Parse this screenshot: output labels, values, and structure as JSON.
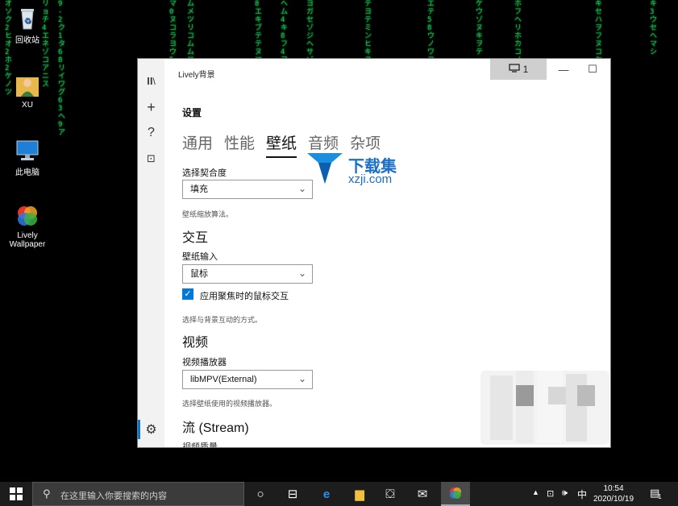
{
  "desktop": {
    "icons": [
      {
        "label": "回收站",
        "icon": "recycle-bin-icon"
      },
      {
        "label": "XU",
        "icon": "user-folder-icon"
      },
      {
        "label": "此电脑",
        "icon": "computer-icon"
      },
      {
        "label": "Lively Wallpaper",
        "icon": "lively-app-icon"
      }
    ],
    "matrix_columns": [
      "オ\nソ\nク\n2\nヒ\nオ\n2\nホ\n2\nケ\nノ\nツ",
      "リ\nョ\nチ\n4\nエ\nネ\nゾ\nコ\nア\nニ\nス",
      "9\n-\n2\nク\n1\nタ\n6\n8\nリ\nイ\nワ\nグ\n6\n3\nヘ\n9\nア",
      "マ\n0\nヌ\nコ\nラ\nヨ\nウ\n5",
      "ム\nメ\nツ\nリ\nコ\nム\nム\nサ\nリ\nセ",
      "8\nエ\nキ\nブ\nテ\nテ\nヌ\nマ\nヒ\nブ\nウ\nワ\nコ\nジ\nヌ",
      "ヘ\nム\n4\nキ\n8\nフ\n4\nヲ",
      "ヨ\nガ\nセ\nゾ\nジ\nヘ\nサ\nゾ\nウ\nク\n4\n2",
      "テ\nヨ\nテ\nミ\nン\nヒ\nキ\nヌ\nヨ\nハ",
      "エ\nテ\n5\n8\nウ\nノ\nワ\nヨ",
      "ケ\nウ\nゾ\nヌ\nキ\nヲ\nテ",
      "ホ\nフ\nヘ\nリ\nホ\nカ\nコ\nノ",
      "キ\nセ\nハ\nヲ\nフ\nヌ\nコ\nケ\nホ\nウ\nノ\nミ",
      "キ\n3\nウ\nセ\nヘ\nマ\nシ"
    ]
  },
  "window": {
    "app_title": "Lively背景",
    "monitor_button": "1",
    "minimize": "—",
    "maximize": "☐",
    "close": "✕",
    "rail_icons": [
      "library-icon",
      "add-icon",
      "help-icon",
      "feedback-icon",
      "settings-icon"
    ],
    "rail_glyphs": {
      "library": "𝐈𝐈\\",
      "add": "+",
      "help": "?",
      "feedback": "⊡",
      "settings": "⚙"
    },
    "settings_title": "设置",
    "tabs": [
      "通用",
      "性能",
      "壁纸",
      "音频",
      "杂项"
    ],
    "active_tab": "壁纸",
    "fit_label": "选择契合度",
    "fit_value": "填充",
    "fit_hint": "壁纸缩放算法。",
    "interaction_section": "交互",
    "input_label": "壁纸输入",
    "input_value": "鼠标",
    "focus_check_label": "应用聚焦时的鼠标交互",
    "focus_check_checked": true,
    "input_hint": "选择与背景互动的方式。",
    "video_section": "视频",
    "player_label": "视频播放器",
    "player_value": "libMPV(External)",
    "player_hint": "选择壁纸使用的视频播放器。",
    "stream_section": "流 (Stream)",
    "stream_cut_label": "视频质量"
  },
  "watermark": {
    "line1": "下载集",
    "line2": "xzji.com"
  },
  "taskbar": {
    "search_placeholder": "在这里输入你要搜索的内容",
    "ime": "中",
    "time": "10:54",
    "date": "2020/10/19",
    "notification_count": "1"
  },
  "colors": {
    "accent": "#0078d7",
    "matrix": "#1fd34a",
    "taskbar": "#1d1d1d"
  }
}
